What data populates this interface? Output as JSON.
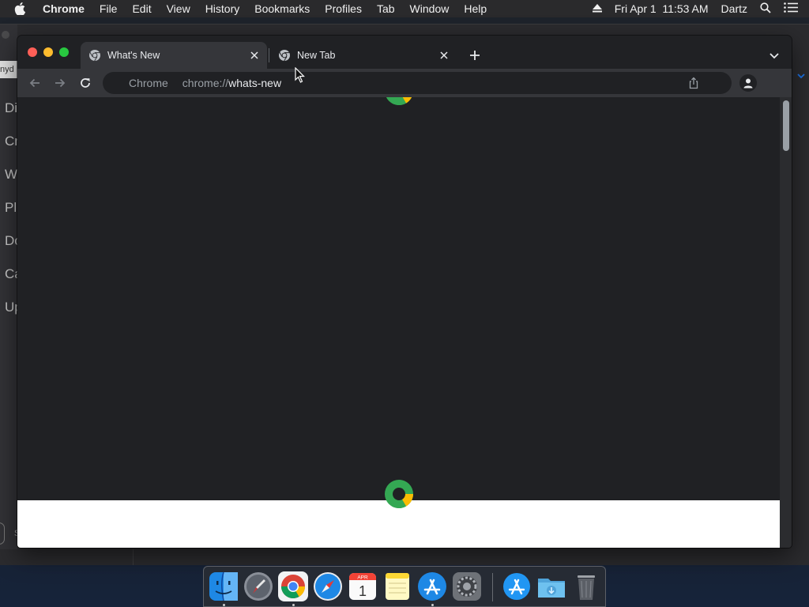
{
  "menubar": {
    "app_name": "Chrome",
    "items": [
      "File",
      "Edit",
      "View",
      "History",
      "Bookmarks",
      "Profiles",
      "Tab",
      "Window",
      "Help"
    ],
    "datetime": "Fri Apr 1  11:53 AM",
    "user": "Dartz"
  },
  "background_window": {
    "tab_label": "nyd",
    "sidebar_labels": [
      "Di",
      "Cr",
      "W",
      "Pl",
      "Do",
      "Ca",
      "Up"
    ],
    "footer_text": "S"
  },
  "chrome": {
    "tabs": [
      {
        "title": "What's New",
        "active": true
      },
      {
        "title": "New Tab",
        "active": false
      }
    ],
    "omnibox": {
      "chip": "Chrome",
      "url_prefix": "chrome://",
      "url_host": "whats-new"
    }
  },
  "dock": {
    "apps": [
      "Finder",
      "Launchpad",
      "Google Chrome",
      "Safari",
      "Calendar",
      "Notes",
      "App Store",
      "System Preferences",
      "Applications",
      "Downloads",
      "Trash"
    ],
    "calendar_month": "APR",
    "calendar_day": "1"
  },
  "colors": {
    "accent_blue": "#1a73e8",
    "traffic_red": "#ff5f57",
    "traffic_yellow": "#febc2e",
    "traffic_green": "#28c840"
  }
}
